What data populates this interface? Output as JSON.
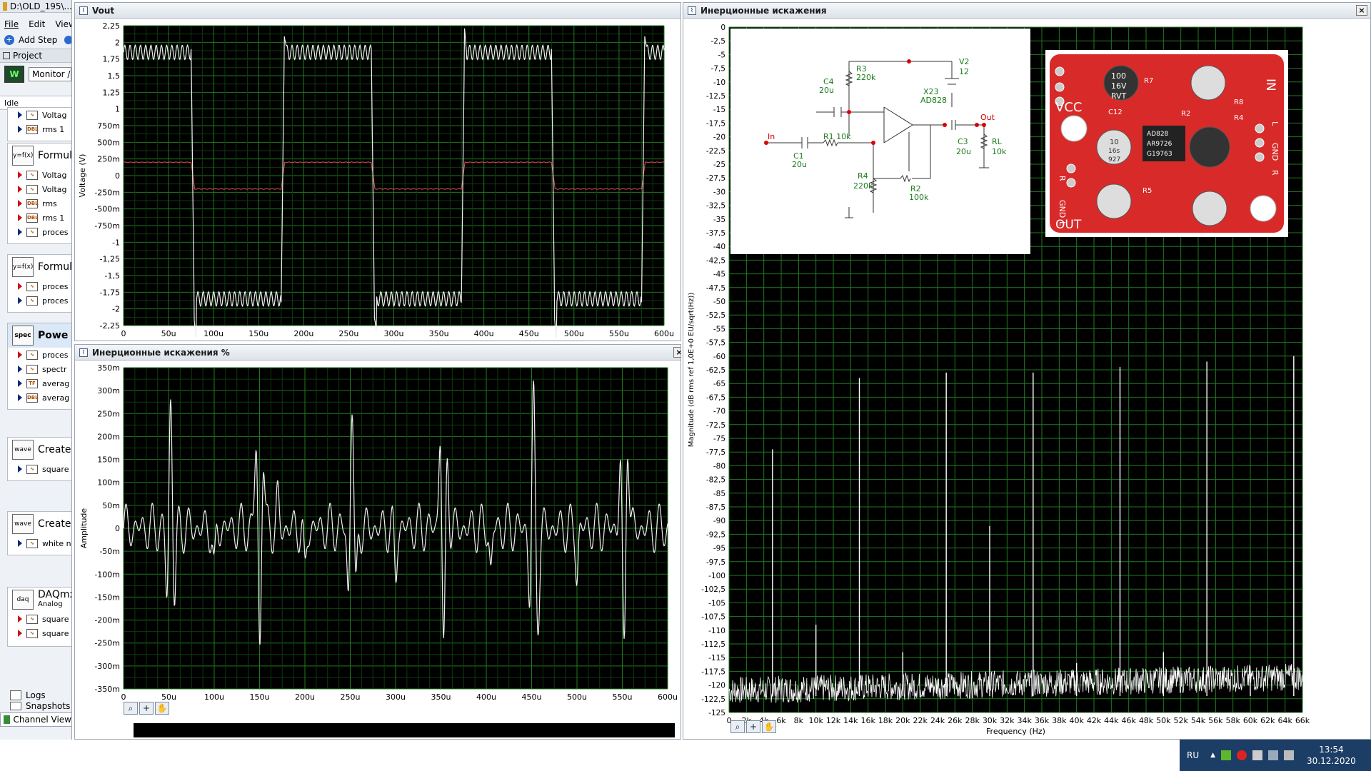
{
  "app": {
    "title": "D:\\OLD_195\\...",
    "menu": [
      "File",
      "Edit",
      "View"
    ],
    "add_step": "Add Step",
    "project": "Project",
    "monitor": "Monitor /",
    "status": "Idle",
    "logs": "Logs",
    "snapshots": "Snapshots",
    "channel_view": "Channel View"
  },
  "groups": [
    {
      "title": "",
      "items": [
        {
          "label": "Voltag",
          "icon": "waveform",
          "kind": "blue"
        },
        {
          "label": "rms 1",
          "icon": "DBL",
          "kind": "blue"
        }
      ]
    },
    {
      "title": "Formul",
      "icon": "y=f(x)",
      "items": [
        {
          "label": "Voltag",
          "icon": "waveform",
          "kind": "red"
        },
        {
          "label": "Voltag",
          "icon": "waveform",
          "kind": "red"
        },
        {
          "label": "rms",
          "icon": "DBL",
          "kind": "red"
        },
        {
          "label": "rms 1",
          "icon": "DBL",
          "kind": "red"
        },
        {
          "label": "proces",
          "icon": "waveform",
          "kind": "blue"
        }
      ]
    },
    {
      "title": "Formul",
      "icon": "y=f(x)",
      "items": [
        {
          "label": "proces",
          "icon": "waveform",
          "kind": "red"
        },
        {
          "label": "proces",
          "icon": "waveform",
          "kind": "blue"
        }
      ]
    },
    {
      "title": "Powe",
      "icon": "spec",
      "items": [
        {
          "label": "proces",
          "icon": "waveform",
          "kind": "red"
        },
        {
          "label": "spectr",
          "icon": "spec",
          "kind": "blue"
        },
        {
          "label": "averag",
          "icon": "TF",
          "kind": "blue"
        },
        {
          "label": "averag",
          "icon": "DBL",
          "kind": "blue"
        }
      ]
    },
    {
      "title": "Create",
      "icon": "wave",
      "items": [
        {
          "label": "square",
          "icon": "waveform",
          "kind": "blue"
        }
      ]
    },
    {
      "title": "Create",
      "icon": "wave",
      "items": [
        {
          "label": "white n",
          "icon": "waveform",
          "kind": "blue"
        }
      ]
    },
    {
      "title": "DAQmx",
      "subtitle": "Analog",
      "icon": "daq",
      "items": [
        {
          "label": "square",
          "icon": "waveform",
          "kind": "red"
        },
        {
          "label": "square",
          "icon": "waveform",
          "kind": "red"
        }
      ]
    }
  ],
  "vout": {
    "title": "Vout",
    "ylabel": "Voltage (V)",
    "ymin": -2.25,
    "ymax": 2.25,
    "yticks": [
      "2,25",
      "2",
      "1,75",
      "1,5",
      "1,25",
      "1",
      "750m",
      "500m",
      "250m",
      "0",
      "-250m",
      "-500m",
      "-750m",
      "-1",
      "-1,25",
      "-1,5",
      "-1,75",
      "-2",
      "-2,25"
    ],
    "xticks": [
      "0",
      "50u",
      "100u",
      "150u",
      "200u",
      "250u",
      "300u",
      "350u",
      "400u",
      "450u",
      "500u",
      "550u",
      "600u"
    ],
    "trace_white": "#f0f0f0",
    "trace_red": "#e05050"
  },
  "dist": {
    "title": "Инерционные искажения %",
    "ylabel": "Amplitude",
    "ymin": -350,
    "ymax": 350,
    "yticks": [
      "350m",
      "300m",
      "250m",
      "200m",
      "150m",
      "100m",
      "50m",
      "0",
      "-50m",
      "-100m",
      "-150m",
      "-200m",
      "-250m",
      "-300m",
      "-350m"
    ],
    "xticks": [
      "0",
      "50u",
      "100u",
      "150u",
      "200u",
      "250u",
      "300u",
      "350u",
      "400u",
      "450u",
      "500u",
      "550u",
      "600u"
    ]
  },
  "spectrum": {
    "title": "Инерционные искажения",
    "ylabel": "Magnitude (dB rms ref 1,0E+0 EU/sqrt(Hz))",
    "xlabel": "Frequency (Hz)",
    "ymin": -125,
    "ymax": 0,
    "yticks": [
      "0",
      "-2,5",
      "-5",
      "-7,5",
      "-10",
      "-12,5",
      "-15",
      "-17,5",
      "-20",
      "-22,5",
      "-25",
      "-27,5",
      "-30",
      "-32,5",
      "-35",
      "-37,5",
      "-40",
      "-42,5",
      "-45",
      "-47,5",
      "-50",
      "-52,5",
      "-55",
      "-57,5",
      "-60",
      "-62,5",
      "-65",
      "-67,5",
      "-70",
      "-72,5",
      "-75",
      "-77,5",
      "-80",
      "-82,5",
      "-85",
      "-87,5",
      "-90",
      "-92,5",
      "-95",
      "-97,5",
      "-100",
      "-102,5",
      "-105",
      "-107,5",
      "-110",
      "-112,5",
      "-115",
      "-117,5",
      "-120",
      "-122,5",
      "-125"
    ],
    "xticks": [
      "0",
      "2k",
      "4k",
      "6k",
      "8k",
      "10k",
      "12k",
      "14k",
      "16k",
      "18k",
      "20k",
      "22k",
      "24k",
      "26k",
      "28k",
      "30k",
      "32k",
      "34k",
      "36k",
      "38k",
      "40k",
      "42k",
      "44k",
      "46k",
      "48k",
      "50k",
      "52k",
      "54k",
      "56k",
      "58k",
      "60k",
      "62k",
      "64k",
      "66k"
    ]
  },
  "chart_data": {
    "type": "bar",
    "x": [
      5000,
      10000,
      15000,
      20000,
      25000,
      30000,
      35000,
      40000,
      45000,
      50000,
      55000,
      60000,
      65000
    ],
    "values": [
      -77,
      -109,
      -64,
      -114,
      -63,
      -91,
      -63,
      -116,
      -62,
      -114,
      -61,
      -118,
      -60
    ],
    "xlabel": "Frequency (Hz)",
    "ylabel": "Magnitude (dB rms ref 1,0E+0 EU/sqrt(Hz))",
    "xlim": [
      0,
      66000
    ],
    "ylim": [
      -125,
      0
    ]
  },
  "schematic": {
    "labels": [
      "R3",
      "220k",
      "V2",
      "12",
      "C4",
      "20u",
      "X23",
      "AD828",
      "R1 10k",
      "C3",
      "20u",
      "In",
      "Out",
      "RL",
      "10k",
      "C1",
      "20u",
      "R4",
      "220k",
      "R2",
      "100k"
    ]
  },
  "pcb": {
    "labels": [
      "VCC",
      "IN",
      "OUT",
      "GND",
      "GND",
      "R",
      "L",
      "R",
      "L",
      "C12",
      "R7",
      "R2",
      "R4",
      "R8",
      "R5",
      "AD828",
      "AR9726",
      "G19763",
      "100",
      "16V",
      "RVT",
      "10",
      "16s",
      "927"
    ]
  },
  "tray": {
    "lang": "RU",
    "time": "13:54",
    "date": "30.12.2020"
  }
}
